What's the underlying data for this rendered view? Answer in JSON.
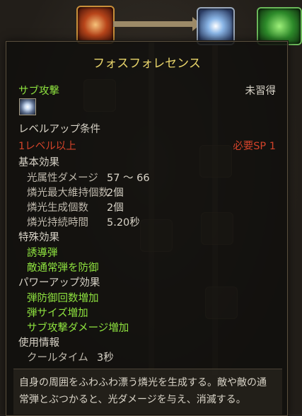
{
  "tooltip": {
    "title": "フォスフォレセンス",
    "skill_type": "サブ攻撃",
    "status": "未習得",
    "levelup_header": "レベルアップ条件",
    "levelup_req": "1レベル以上",
    "sp_req": "必要SP 1",
    "basic_header": "基本効果",
    "basic": [
      {
        "label": "光属性ダメージ",
        "value": "57 ～ 66"
      },
      {
        "label": "燐光最大維持個数",
        "value": "2個"
      },
      {
        "label": "燐光生成個数",
        "value": "2個"
      },
      {
        "label": "燐光持続時間",
        "value": "5.20秒"
      }
    ],
    "special_header": "特殊効果",
    "special": [
      "誘導弾",
      "敵通常弾を防御"
    ],
    "powerup_header": "パワーアップ効果",
    "powerup": [
      "弾防御回数増加",
      "弾サイズ増加",
      "サブ攻撃ダメージ増加"
    ],
    "usage_header": "使用情報",
    "cooldown_label": "クールタイム",
    "cooldown_value": "3秒",
    "description": [
      "自身の周囲をふわふわ漂う燐光を生成する。敵や敵の通",
      "常弾とぶつかると、光ダメージを与え、消滅する。"
    ]
  },
  "colors": {
    "title": "#e8d46a",
    "green": "#8ee23f",
    "red": "#d2432a"
  }
}
